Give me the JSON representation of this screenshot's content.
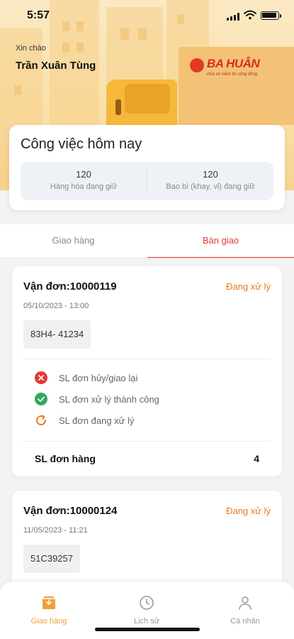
{
  "status_bar": {
    "time": "5:57"
  },
  "header": {
    "greeting": "Xin chào",
    "user_name": "Trần Xuân Tùng",
    "brand_logo": "BA HUÂN"
  },
  "today_card": {
    "title": "Công việc hôm nay",
    "stats": [
      {
        "value": "120",
        "label": "Hàng hóa đang giữ"
      },
      {
        "value": "120",
        "label": "Bao bì (khay, vỉ) đang giữ"
      }
    ]
  },
  "tabs": [
    {
      "label": "Giao hàng",
      "active": false
    },
    {
      "label": "Bàn giao",
      "active": true
    }
  ],
  "orders": [
    {
      "id": "Vận đơn:10000119",
      "status": "Đang xử lý",
      "date": "05/10/2023 - 13:00",
      "plate": "83H4- 41234",
      "summary": [
        {
          "icon": "cancel-icon",
          "label": "SL đơn hủy/giao lại"
        },
        {
          "icon": "check-icon",
          "label": "SL đơn xử lý thành công"
        },
        {
          "icon": "refresh-icon",
          "label": "SL đơn đang xử lý"
        }
      ],
      "total_label": "SL đơn hàng",
      "total_value": "4"
    },
    {
      "id": "Vận đơn:10000124",
      "status": "Đang xử lý",
      "date": "11/05/2023 - 11:21",
      "plate": "51C39257"
    }
  ],
  "bottom_nav": [
    {
      "label": "Giao hàng",
      "icon": "box-icon",
      "active": true
    },
    {
      "label": "Lịch sử",
      "icon": "clock-icon",
      "active": false
    },
    {
      "label": "Cá nhân",
      "icon": "user-icon",
      "active": false
    }
  ],
  "colors": {
    "accent": "#f07a1a",
    "tab_active": "#e53935",
    "nav_active": "#f0a03a"
  }
}
